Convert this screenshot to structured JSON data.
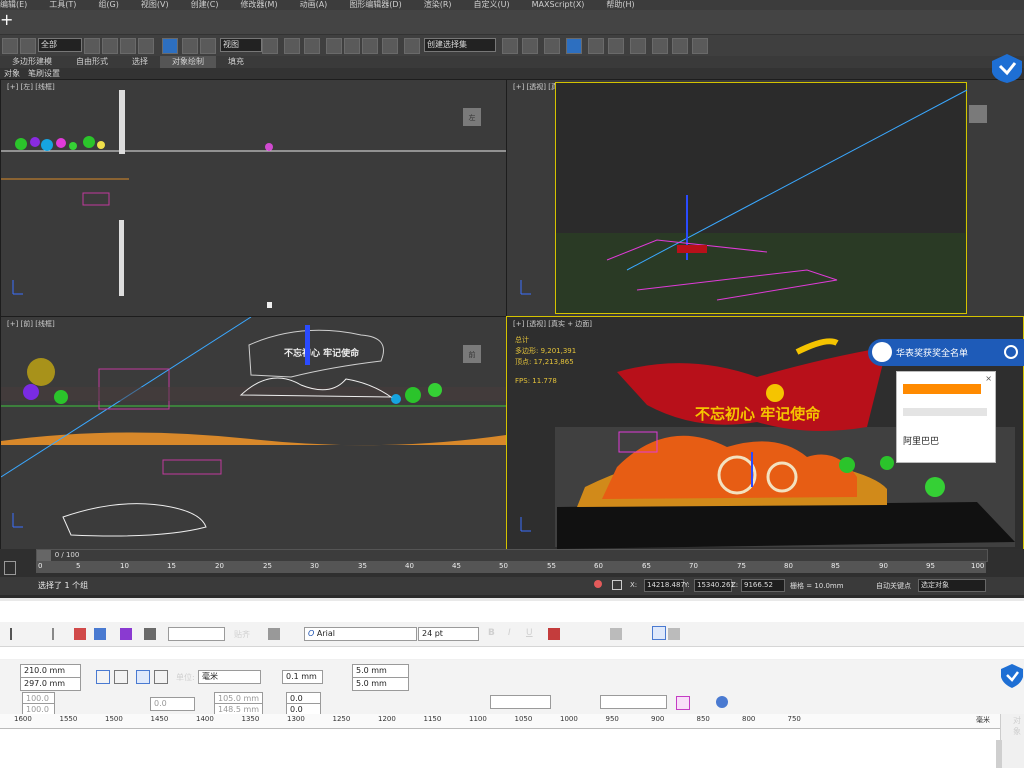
{
  "menubar": {
    "items": [
      "编辑(E)",
      "工具(T)",
      "组(G)",
      "视图(V)",
      "创建(C)",
      "修改器(M)",
      "动画(A)",
      "图形编辑器(D)",
      "渲染(R)",
      "自定义(U)",
      "MAXScript(X)",
      "帮助(H)"
    ]
  },
  "toolbar": {
    "filter_select": "全部",
    "view_select": "视图",
    "selection_set": "创建选择集"
  },
  "ribbon": {
    "tabs": [
      "对象绘制"
    ],
    "labels": [
      "多边形建模",
      "自由形式",
      "选择",
      "对象绘制",
      "填充"
    ],
    "subtabs": [
      "对象",
      "笔刷设置"
    ]
  },
  "viewports": {
    "top_left": {
      "label": "[+] [左] [线框]"
    },
    "top_right": {
      "label": "[+] [透视] [真实]"
    },
    "bottom_left": {
      "label": "[+] [前] [线框]"
    },
    "bottom_right": {
      "label": "[+] [透视] [真实 + 边面]",
      "stats_total": "总计",
      "stats_polys_label": "多边形:",
      "stats_polys": "9,201,391",
      "stats_verts_label": "顶点:",
      "stats_verts": "17,213,865",
      "fps_label": "FPS:",
      "fps": "11.778"
    },
    "cube_left": "左",
    "cube_front": "前"
  },
  "scene": {
    "slogan": "不忘初心 牢记使命",
    "slogan_outline": "不忘初心 牢记使命"
  },
  "timeline": {
    "frame_counter": "0 / 100",
    "ticks": [
      "0",
      "5",
      "10",
      "15",
      "20",
      "25",
      "30",
      "35",
      "40",
      "45",
      "50",
      "55",
      "60",
      "65",
      "70",
      "75",
      "80",
      "85",
      "90",
      "95",
      "100"
    ]
  },
  "status": {
    "message": "选择了 1 个组",
    "x_label": "X:",
    "x": "14218.487",
    "y_label": "Y:",
    "y": "15340.261",
    "z_label": "Z:",
    "z": "9166.52",
    "grid": "栅格 = 10.0mm",
    "autokey": "自动关键点",
    "selected": "选定对象"
  },
  "search_popup": {
    "query": "华表奖获奖全名单",
    "link1": "阿里巴巴"
  },
  "coreldraw": {
    "align_label": "贴齐",
    "font": "Arial",
    "font_size": "24 pt",
    "width": "210.0 mm",
    "height": "297.0 mm",
    "unit_label": "单位:",
    "unit": "毫米",
    "nudge": "0.1 mm",
    "dup_x": "5.0 mm",
    "dup_y": "5.0 mm",
    "scale_x": "100.0",
    "scale_y": "100.0",
    "rotate": "0.0",
    "pos_x": "105.0 mm",
    "pos_y": "148.5 mm",
    "off_x": "0.0",
    "off_y": "0.0",
    "ruler_ticks": [
      "1600",
      "1550",
      "1500",
      "1450",
      "1400",
      "1350",
      "1300",
      "1250",
      "1200",
      "1150",
      "1100",
      "1050",
      "1000",
      "950",
      "900",
      "850",
      "800",
      "750"
    ],
    "ruler_unit": "毫米",
    "side_label": "对象"
  },
  "colors": {
    "viewport_bg": "#3b3b3b",
    "active_border": "#d4c300",
    "search_blue": "#1e5bb8",
    "flag_red": "#b8101a",
    "slogan_gold": "#f5c400"
  },
  "chart_data": {
    "type": "table",
    "title": "",
    "rows": [
      [
        "总计",
        ""
      ],
      [
        "多边形:",
        "9,201,391"
      ],
      [
        "顶点:",
        "17,213,865"
      ],
      [
        "FPS:",
        "11.778"
      ]
    ]
  }
}
